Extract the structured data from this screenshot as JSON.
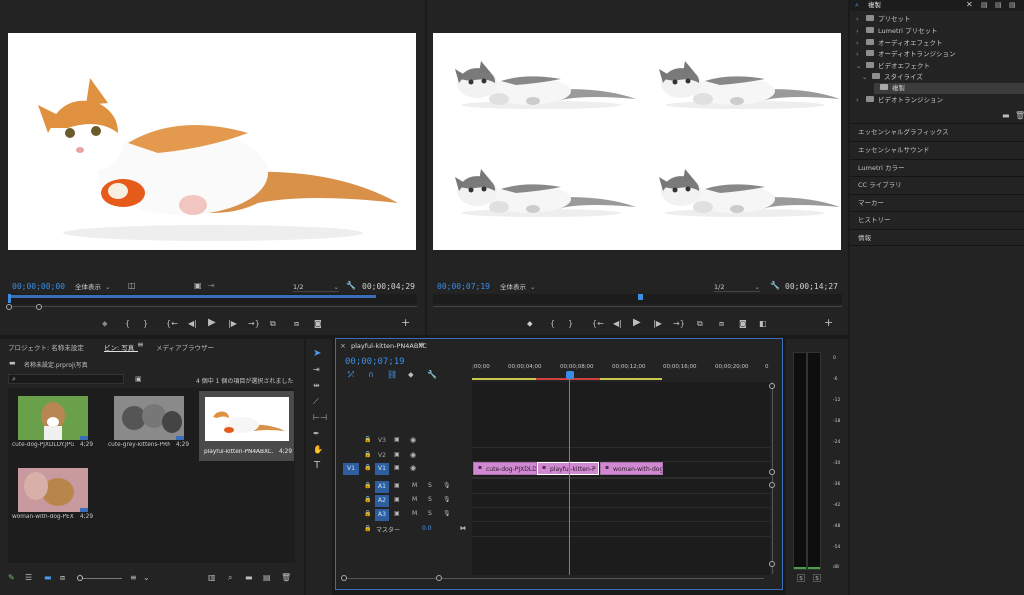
{
  "source_monitor": {
    "timecode_in": "00;00;00;00",
    "fit": "全体表示",
    "resolution": "1/2",
    "duration": "00;00;04;29"
  },
  "program_monitor": {
    "timecode": "00;00;07;19",
    "fit": "全体表示",
    "resolution": "1/2",
    "duration": "00;00;14;27"
  },
  "effects": {
    "search_value": "複製",
    "tree": [
      {
        "label": "プリセット",
        "expanded": false
      },
      {
        "label": "Lumetri プリセット",
        "expanded": false
      },
      {
        "label": "オーディオエフェクト",
        "expanded": false
      },
      {
        "label": "オーディオトランジション",
        "expanded": false
      },
      {
        "label": "ビデオエフェクト",
        "expanded": true
      },
      {
        "label": "スタイライズ",
        "expanded": true
      },
      {
        "label": "複製",
        "expanded": false
      },
      {
        "label": "ビデオトランジション",
        "expanded": false
      }
    ],
    "sections": [
      "エッセンシャルグラフィックス",
      "エッセンシャルサウンド",
      "Lumetri カラー",
      "CC ライブラリ",
      "マーカー",
      "ヒストリー",
      "情報"
    ]
  },
  "project": {
    "tabs": [
      "プロジェクト: 名称未設定",
      "ビン: 写真",
      "メディアブラウザー"
    ],
    "path": "名称未設定.prproj\\写真",
    "selection_status": "4 個中 1 個の項目が選択されました",
    "items": [
      {
        "name": "cute-dog-PJXDLDY.JPG",
        "duration": "4;29"
      },
      {
        "name": "cute-grey-kittens-PRNH...",
        "duration": "4;29"
      },
      {
        "name": "playful-kitten-PN4ABXC...",
        "duration": "4;29"
      },
      {
        "name": "woman-with-dog-PEXD...",
        "duration": "4;29"
      }
    ]
  },
  "timeline": {
    "sequence_name": "playful-kitten-PN4ABXC",
    "timecode": "00;00;07;19",
    "ruler": [
      ";00;00",
      "00;00;04;00",
      "00;00;08;00",
      "00;00;12;00",
      "00;00;16;00",
      "00;00;20;00",
      "0"
    ],
    "video_tracks": [
      "V3",
      "V2",
      "V1"
    ],
    "audio_tracks": [
      "A1",
      "A2",
      "A3"
    ],
    "source_patch": "V1",
    "master_label": "マスター",
    "master_value": "0.0",
    "clips": [
      {
        "name": "cute-dog-PJXDLD"
      },
      {
        "name": "playful-kitten-P"
      },
      {
        "name": "woman-with-dog"
      }
    ]
  },
  "audio_meter": {
    "scale": [
      "0",
      "-6",
      "-12",
      "-18",
      "-24",
      "-30",
      "-36",
      "-42",
      "-48",
      "-54",
      "dB"
    ],
    "solo": [
      "S",
      "S"
    ]
  },
  "colors": {
    "accent": "#3a8ee6",
    "clip": "#d089d0",
    "playhead": "#3a8ee6"
  }
}
